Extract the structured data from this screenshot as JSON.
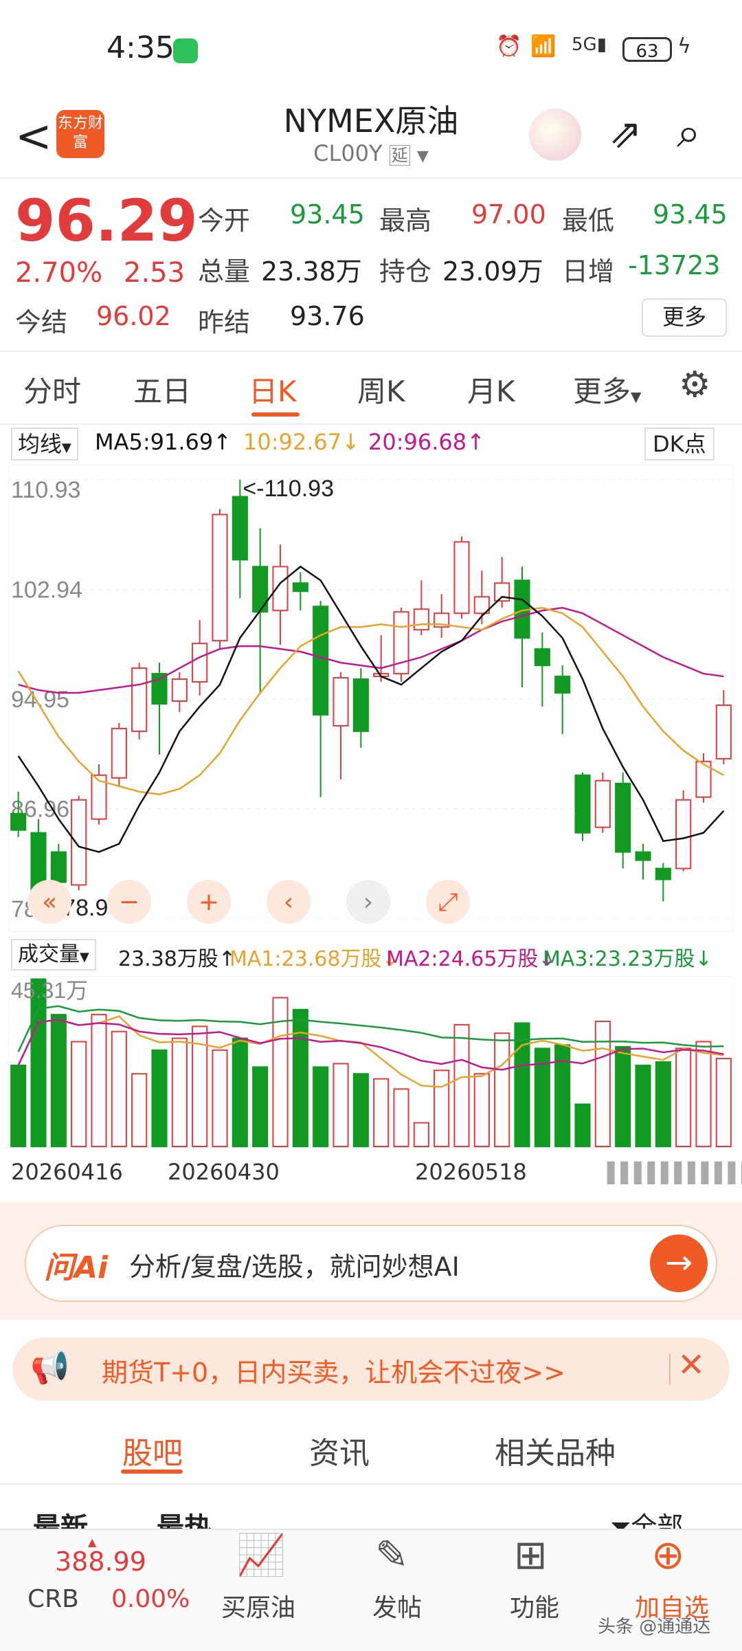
{
  "status": {
    "time": "4:35",
    "battery": "63"
  },
  "header": {
    "logo": "东方财富",
    "title": "NYMEX原油",
    "code": "CL00Y",
    "delay_badge": "延"
  },
  "quote": {
    "price": "96.29",
    "pct": "2.70%",
    "change": "2.53",
    "settle_label": "今结",
    "settle": "96.02",
    "open_label": "今开",
    "open": "93.45",
    "high_label": "最高",
    "high": "97.00",
    "low_label": "最低",
    "low": "93.45",
    "vol_label": "总量",
    "vol": "23.38万",
    "oi_label": "持仓",
    "oi": "23.09万",
    "daily_label": "日增",
    "daily": "-13723",
    "prev_label": "昨结",
    "prev": "93.76",
    "more": "更多"
  },
  "tabs": [
    "分时",
    "五日",
    "日K",
    "周K",
    "月K",
    "更多"
  ],
  "ma": {
    "select": "均线",
    "ma5": "MA5:91.69",
    "ma10": "10:92.67",
    "ma20": "20:96.68",
    "dk": "DK点"
  },
  "chart_data": {
    "type": "candlestick",
    "ylim": [
      78.97,
      110.93
    ],
    "y_ticks": [
      "110.93",
      "102.94",
      "94.95",
      "86.96",
      "78.97"
    ],
    "max_label": "<-110.93",
    "min_label": "<-78.97",
    "candles": [
      [
        86.6,
        85.4,
        88.2,
        84.9
      ],
      [
        85.2,
        80.4,
        86.2,
        78.97
      ],
      [
        83.8,
        81.6,
        84.4,
        81.2
      ],
      [
        81.4,
        87.6,
        87.9,
        81.0
      ],
      [
        86.2,
        89.4,
        90.2,
        85.8
      ],
      [
        89.2,
        92.8,
        93.2,
        88.6
      ],
      [
        92.6,
        97.2,
        97.6,
        92.0
      ],
      [
        96.8,
        94.6,
        97.6,
        90.9
      ],
      [
        94.8,
        96.4,
        96.9,
        94.0
      ],
      [
        96.2,
        99.0,
        100.7,
        95.2
      ],
      [
        99.2,
        108.4,
        108.8,
        98.6
      ],
      [
        109.7,
        105.1,
        110.93,
        102.3
      ],
      [
        104.6,
        101.3,
        107.4,
        95.4
      ],
      [
        101.4,
        104.6,
        106.2,
        98.9
      ],
      [
        103.4,
        102.8,
        104.2,
        101.4
      ],
      [
        101.7,
        93.8,
        102.1,
        87.8
      ],
      [
        93.0,
        96.5,
        96.9,
        89.1
      ],
      [
        96.4,
        92.6,
        97.2,
        91.4
      ],
      [
        96.6,
        96.8,
        99.6,
        96.2
      ],
      [
        96.8,
        101.3,
        101.6,
        96.2
      ],
      [
        100.0,
        101.5,
        103.6,
        99.6
      ],
      [
        100.2,
        101.2,
        102.6,
        99.4
      ],
      [
        101.2,
        106.4,
        106.8,
        100.8
      ],
      [
        101.2,
        102.4,
        104.3,
        100.4
      ],
      [
        102.1,
        103.4,
        105.3,
        101.6
      ],
      [
        103.6,
        99.4,
        104.6,
        95.8
      ],
      [
        98.6,
        97.4,
        99.8,
        94.4
      ],
      [
        96.6,
        95.4,
        97.4,
        92.4
      ],
      [
        89.4,
        85.2,
        89.6,
        84.6
      ],
      [
        85.6,
        89.0,
        89.6,
        85.2
      ],
      [
        88.8,
        83.8,
        89.6,
        82.6
      ],
      [
        83.8,
        83.2,
        84.4,
        81.8
      ],
      [
        82.6,
        81.8,
        83.0,
        80.2
      ],
      [
        82.6,
        87.6,
        88.3,
        82.4
      ],
      [
        87.8,
        90.4,
        91.0,
        87.4
      ],
      [
        90.6,
        94.5,
        95.6,
        90.2
      ]
    ],
    "ma5": [
      90.8,
      88.6,
      86.2,
      84.2,
      83.8,
      84.4,
      87.2,
      89.6,
      92.6,
      94.4,
      96.0,
      99.4,
      101.4,
      103.4,
      104.6,
      103.6,
      101.2,
      98.8,
      96.6,
      96.0,
      97.2,
      98.4,
      99.2,
      101.0,
      102.4,
      102.2,
      101.0,
      99.4,
      96.4,
      92.8,
      90.0,
      87.6,
      84.6,
      84.8,
      85.2,
      86.8
    ],
    "ma10": [
      97.0,
      94.6,
      92.2,
      90.4,
      89.0,
      88.6,
      88.2,
      88.0,
      88.4,
      89.4,
      91.0,
      93.4,
      95.4,
      97.2,
      98.8,
      99.6,
      100.2,
      100.2,
      100.4,
      100.2,
      100.4,
      100.4,
      100.2,
      100.0,
      100.8,
      101.4,
      101.6,
      101.2,
      100.2,
      98.4,
      96.6,
      94.4,
      92.6,
      91.2,
      90.2,
      89.4
    ],
    "ma20": [
      96.0,
      95.6,
      95.4,
      95.4,
      95.6,
      95.8,
      96.0,
      96.4,
      97.2,
      98.0,
      98.6,
      98.8,
      98.8,
      98.6,
      98.4,
      98.0,
      97.6,
      97.4,
      97.2,
      97.6,
      98.0,
      98.6,
      99.2,
      100.0,
      100.6,
      101.0,
      101.4,
      101.6,
      101.2,
      100.4,
      99.6,
      98.8,
      98.0,
      97.4,
      96.8,
      96.6
    ],
    "volumes": [
      0.48,
      0.99,
      0.78,
      0.62,
      0.78,
      0.68,
      0.43,
      0.57,
      0.64,
      0.71,
      0.57,
      0.64,
      0.47,
      0.88,
      0.81,
      0.47,
      0.49,
      0.43,
      0.4,
      0.34,
      0.14,
      0.45,
      0.72,
      0.43,
      0.67,
      0.73,
      0.58,
      0.6,
      0.25,
      0.74,
      0.59,
      0.48,
      0.5,
      0.58,
      0.62,
      0.52
    ],
    "vol_max_label": "45.31万",
    "dates": [
      "20260416",
      "20260430",
      "20260518"
    ]
  },
  "volume": {
    "select": "成交量",
    "total": "23.38万股",
    "ma1": "MA1:23.68万股",
    "ma2": "MA2:24.65万股",
    "ma3": "MA3:23.23万股"
  },
  "ai": {
    "logo": "问Ai",
    "text": "分析/复盘/选股，就问妙想AI"
  },
  "promo": {
    "text": "期货T+0，日内买卖，让机会不过夜>>"
  },
  "bottom_tabs": [
    "股吧",
    "资讯",
    "相关品种"
  ],
  "sub_tabs": {
    "latest": "最新",
    "hot": "最热",
    "filter": "全部"
  },
  "nav": {
    "crb_value": "388.99",
    "crb_label": "CRB",
    "crb_pct": "0.00%",
    "buy": "买原油",
    "post": "发帖",
    "func": "功能",
    "add": "加自选"
  },
  "watermark": "头条 @通通达",
  "colors": {
    "up": "#e23b3b",
    "down": "#109a22",
    "accent": "#f05a24",
    "ma5": "#111111",
    "ma10": "#e9a22a",
    "ma20": "#c21a8e"
  }
}
